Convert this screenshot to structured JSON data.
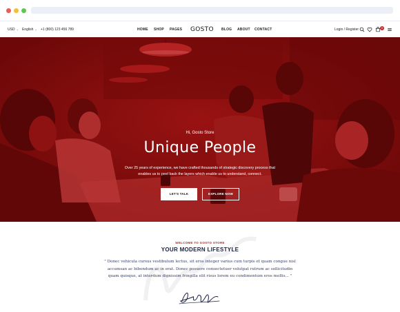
{
  "header": {
    "currency": "USD",
    "language": "English",
    "phone": "+1 (800) 123 456 789",
    "nav_left": [
      "HOME",
      "SHOP",
      "PAGES"
    ],
    "logo": "GOSTO",
    "nav_right": [
      "BLOG",
      "ABOUT",
      "CONTACT"
    ],
    "login": "Login / Register",
    "cart_count": "0",
    "icons": [
      "search-icon",
      "heart-icon",
      "cart-icon",
      "menu-icon"
    ]
  },
  "hero": {
    "greeting": "Hi, Gosto Store",
    "title": "Unique People",
    "description": "Over 25 years of experience, we have crafted thousands of strategic discovery process that enables us to peel back the layers which enable us to understand, connect.",
    "button_primary": "LET'S TALK",
    "button_secondary": "EXPLORE NOW",
    "overlay_color": "#8b0d0d"
  },
  "welcome": {
    "eyebrow": "WELCOME TO GOSTO STORE",
    "title": "YOUR MODERN LIFESTYLE",
    "quote": "\" Donec vehicula cursus vestibulum lectus, sit eros integer varius cum turpis et quam congue nisl accumsan ac bibendum ac in erat. Donec posuere consectetuer volutpat rutrum ac sollicitudin quam quisque, at interdum dignissim fringilla elit risus lorem eu condimentum eros mollis... \""
  },
  "colors": {
    "accent": "#c42525",
    "heading": "#1a1f3c"
  }
}
